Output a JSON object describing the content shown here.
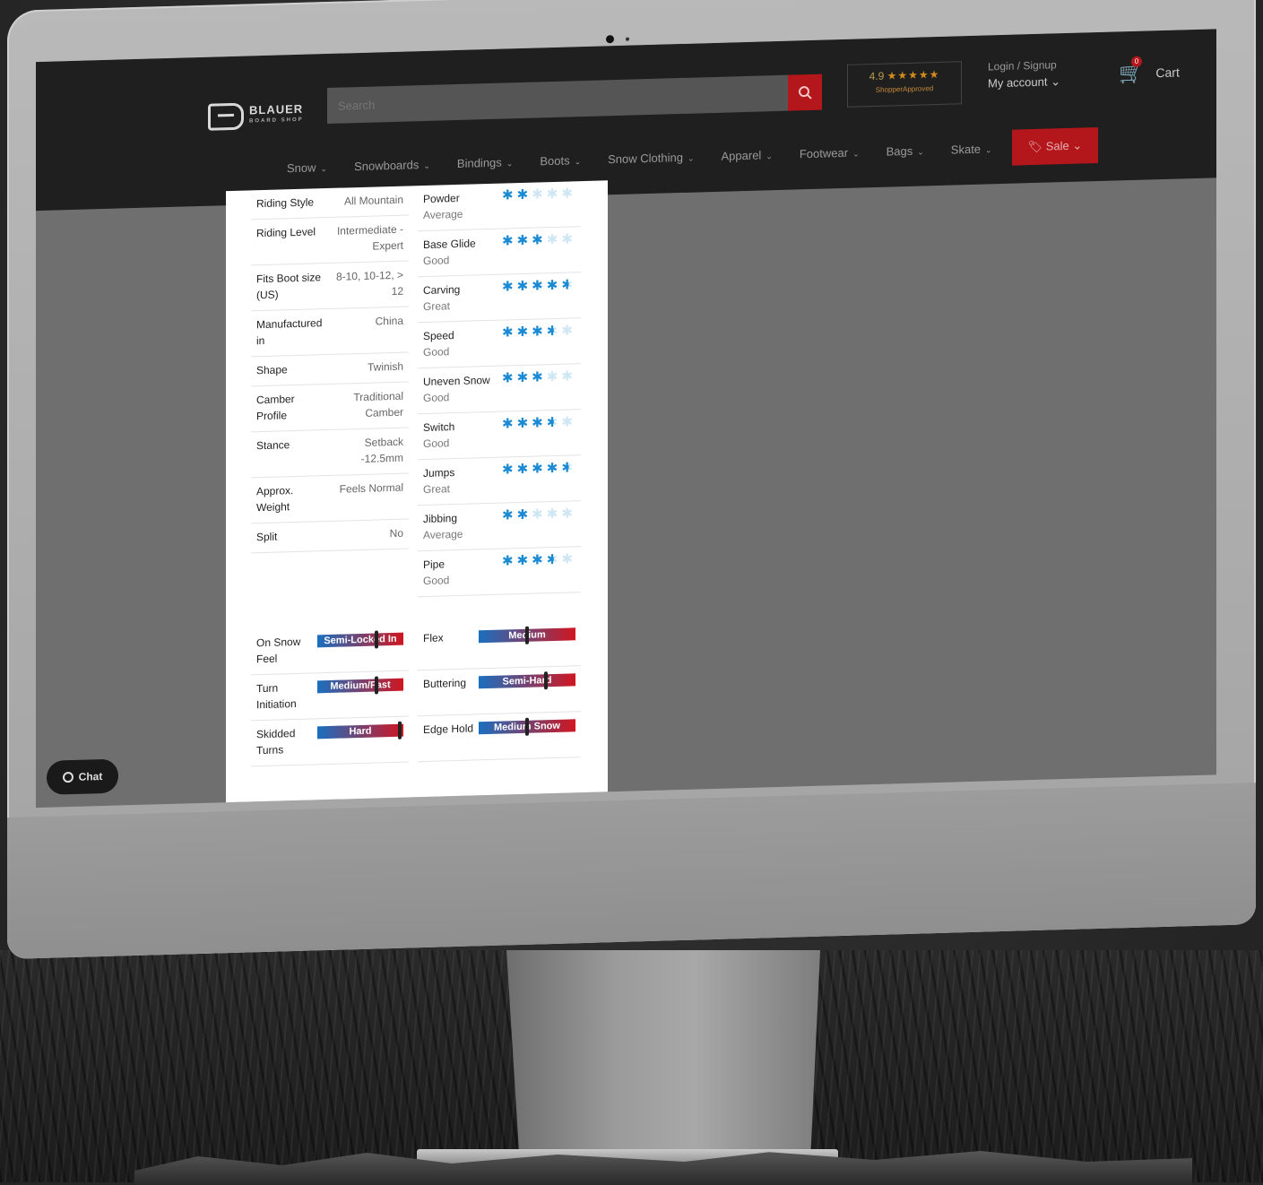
{
  "header": {
    "logo_text": "BLAUER",
    "logo_sub": "BOARD SHOP",
    "search_placeholder": "Search",
    "rating": "4.9",
    "rating_stars": "★★★★★",
    "shopper_approved": "ShopperApproved",
    "login_label": "Login / Signup",
    "account_label": "My account",
    "cart_count": "0",
    "cart_label": "Cart"
  },
  "nav": {
    "items": [
      "Snow",
      "Snowboards",
      "Bindings",
      "Boots",
      "Snow Clothing",
      "Apparel",
      "Footwear",
      "Bags",
      "Skate"
    ],
    "sale_label": "Sale"
  },
  "specs": [
    {
      "label": "Riding Style",
      "value": "All Mountain"
    },
    {
      "label": "Riding Level",
      "value": "Intermediate - Expert"
    },
    {
      "label": "Fits Boot size (US)",
      "value": "8-10, 10-12, > 12"
    },
    {
      "label": "Manufactured in",
      "value": "China"
    },
    {
      "label": "Shape",
      "value": "Twinish"
    },
    {
      "label": "Camber Profile",
      "value": "Traditional Camber"
    },
    {
      "label": "Stance",
      "value": "Setback -12.5mm"
    },
    {
      "label": "Approx. Weight",
      "value": "Feels Normal"
    },
    {
      "label": "Split",
      "value": "No"
    }
  ],
  "ratings": [
    {
      "name": "Powder",
      "level": "Average",
      "score": 2
    },
    {
      "name": "Base Glide",
      "level": "Good",
      "score": 3
    },
    {
      "name": "Carving",
      "level": "Great",
      "score": 4.5
    },
    {
      "name": "Speed",
      "level": "Good",
      "score": 3.5
    },
    {
      "name": "Uneven Snow",
      "level": "Good",
      "score": 3
    },
    {
      "name": "Switch",
      "level": "Good",
      "score": 3.5
    },
    {
      "name": "Jumps",
      "level": "Great",
      "score": 4.5
    },
    {
      "name": "Jibbing",
      "level": "Average",
      "score": 2
    },
    {
      "name": "Pipe",
      "level": "Good",
      "score": 3.5
    }
  ],
  "feel_left": [
    {
      "label": "On Snow Feel",
      "value": "Semi-Locked In",
      "marker": 0.7
    },
    {
      "label": "Turn Initiation",
      "value": "Medium/Fast",
      "marker": 0.7
    },
    {
      "label": "Skidded Turns",
      "value": "Hard",
      "marker": 0.98
    }
  ],
  "feel_right": [
    {
      "label": "Flex",
      "value": "Medium",
      "marker": 0.5
    },
    {
      "label": "Buttering",
      "value": "Semi-Hard",
      "marker": 0.7
    },
    {
      "label": "Edge Hold",
      "value": "Medium Snow",
      "marker": 0.5
    }
  ],
  "chat_label": "Chat",
  "colors": {
    "accent": "#b3161b",
    "flake": "#1a8ad4",
    "bar_start": "#1a6fc0",
    "bar_end": "#d11620"
  }
}
